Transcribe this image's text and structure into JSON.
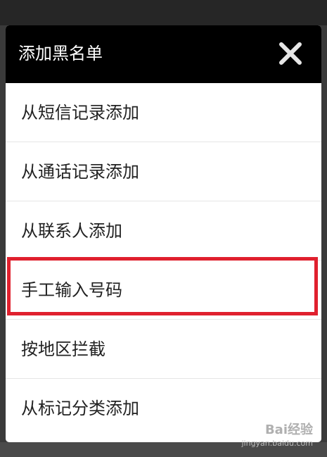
{
  "dialog": {
    "title": "添加黑名单",
    "close_icon": "close-icon"
  },
  "menu": {
    "items": [
      {
        "label": "从短信记录添加"
      },
      {
        "label": "从通话记录添加"
      },
      {
        "label": "从联系人添加"
      },
      {
        "label": "手工输入号码",
        "highlighted": true
      },
      {
        "label": "按地区拦截"
      },
      {
        "label": "从标记分类添加"
      }
    ]
  },
  "annotation": {
    "highlight_color": "#e0202e"
  },
  "watermark": {
    "logo": "Bai经验",
    "url": "jingyan.baidu.com"
  },
  "colors": {
    "header_bg": "#000000",
    "item_bg": "#ffffff",
    "item_text": "#222222"
  }
}
